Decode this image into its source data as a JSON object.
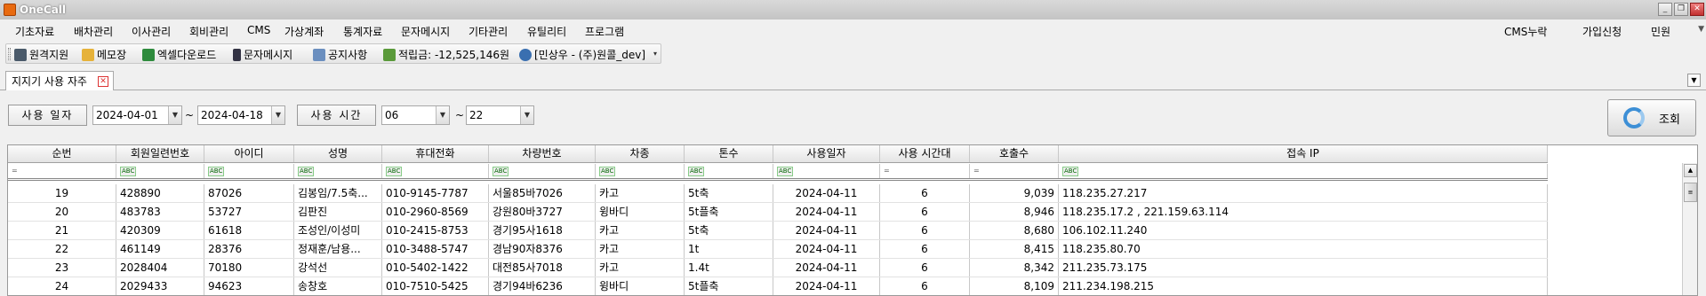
{
  "window": {
    "title": "OneCall"
  },
  "menu": {
    "items": [
      "기초자료",
      "배차관리",
      "이사관리",
      "회비관리",
      "CMS",
      "가상계좌",
      "통계자료",
      "문자메시지",
      "기타관리",
      "유틸리티",
      "프로그램"
    ],
    "right": [
      "CMS누락",
      "가입신청",
      "민원"
    ]
  },
  "toolbar": {
    "remote": "원격지원",
    "memo": "메모장",
    "excel": "엑셀다운로드",
    "sms": "문자메시지",
    "notice": "공지사항",
    "points": "적립금: -12,525,146원",
    "user": "[민상우 - (주)원콜_dev]"
  },
  "tab": {
    "label": "지지기 사용 자주"
  },
  "filter": {
    "date_label": "사용 일자",
    "date_from": "2024-04-01",
    "date_to": "2024-04-18",
    "tilde": "~",
    "time_label": "사용 시간",
    "time_from": "06",
    "time_to": "22",
    "search_label": "조회"
  },
  "grid": {
    "columns": [
      "순번",
      "회원일련번호",
      "아이디",
      "성명",
      "휴대전화",
      "차량번호",
      "차종",
      "톤수",
      "사용일자",
      "사용 시간대",
      "호출수",
      "접속 IP"
    ],
    "filter_row": [
      "=",
      "ABC",
      "ABC",
      "ABC",
      "ABC",
      "ABC",
      "ABC",
      "ABC",
      "ABC",
      "=",
      "=",
      "ABC"
    ],
    "rows": [
      [
        "19",
        "428890",
        "87026",
        "김봉임/7.5축...",
        "010-9145-7787",
        "서울85바7026",
        "카고",
        "5t축",
        "2024-04-11",
        "6",
        "9,039",
        "118.235.27.217"
      ],
      [
        "20",
        "483783",
        "53727",
        "김판진",
        "010-2960-8569",
        "강원80바3727",
        "윙바디",
        "5t플축",
        "2024-04-11",
        "6",
        "8,946",
        "118.235.17.2 , 221.159.63.114"
      ],
      [
        "21",
        "420309",
        "61618",
        "조성인/이성미",
        "010-2415-8753",
        "경기95사1618",
        "카고",
        "5t축",
        "2024-04-11",
        "6",
        "8,680",
        "106.102.11.240"
      ],
      [
        "22",
        "461149",
        "28376",
        "정재훈/남용...",
        "010-3488-5747",
        "경남90자8376",
        "카고",
        "1t",
        "2024-04-11",
        "6",
        "8,415",
        "118.235.80.70"
      ],
      [
        "23",
        "2028404",
        "70180",
        "강석선",
        "010-5402-1422",
        "대전85사7018",
        "카고",
        "1.4t",
        "2024-04-11",
        "6",
        "8,342",
        "211.235.73.175"
      ],
      [
        "24",
        "2029433",
        "94623",
        "송창호",
        "010-7510-5425",
        "경기94바6236",
        "윙바디",
        "5t플축",
        "2024-04-11",
        "6",
        "8,109",
        "211.234.198.215"
      ]
    ]
  }
}
